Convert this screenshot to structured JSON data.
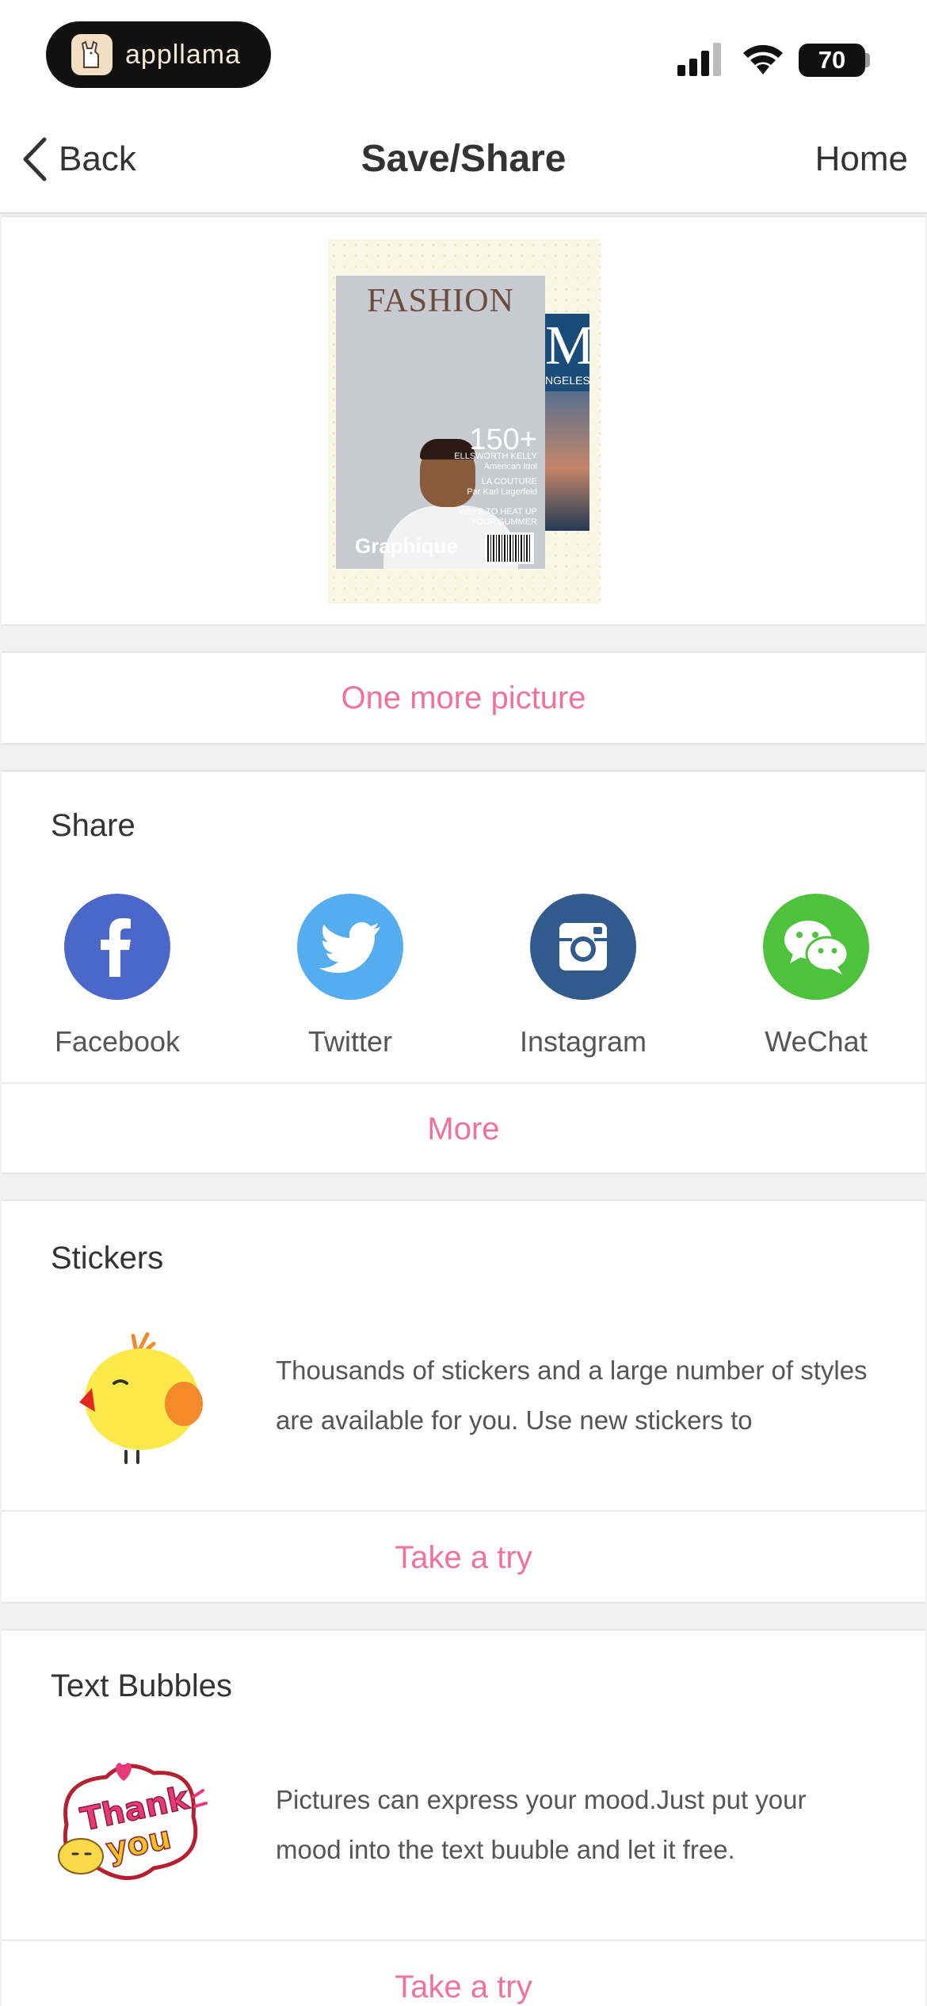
{
  "status_bar": {
    "app_badge": "appllama",
    "battery": "70"
  },
  "nav": {
    "back_label": "Back",
    "title": "Save/Share",
    "home_label": "Home"
  },
  "preview": {
    "magazine_title": "FASHION",
    "headline_number": "150+",
    "cover_lines": [
      "ELLSWORTH KELLY",
      "American Idol",
      "LA COUTURE",
      "Par Karl Lagerfeld",
      "WAYS TO HEAT UP",
      "YOUR SUMMER"
    ],
    "brand": "Graphique",
    "back_cover_letter": "M",
    "back_cover_text": "NGELES"
  },
  "one_more": {
    "label": "One more picture"
  },
  "share": {
    "title": "Share",
    "items": [
      {
        "label": "Facebook",
        "icon": "facebook-icon",
        "color": "#4a67c9"
      },
      {
        "label": "Twitter",
        "icon": "twitter-icon",
        "color": "#55acee"
      },
      {
        "label": "Instagram",
        "icon": "instagram-icon",
        "color": "#305b8c"
      },
      {
        "label": "WeChat",
        "icon": "wechat-icon",
        "color": "#4ec23c"
      }
    ],
    "more_label": "More"
  },
  "stickers": {
    "title": "Stickers",
    "description": "Thousands of stickers and a large number of styles are available for you. Use new stickers to",
    "action_label": "Take a try",
    "image": "yellow-chick-sticker"
  },
  "text_bubbles": {
    "title": "Text Bubbles",
    "description": "Pictures can express your mood.Just put your mood into the text buuble and let it free.",
    "action_label": "Take a try",
    "image": "thank-you-bubble",
    "bubble_text_1": "Thank",
    "bubble_text_2": "you"
  },
  "colors": {
    "accent_pink": "#f0719f",
    "background": "#f1f1f1"
  }
}
